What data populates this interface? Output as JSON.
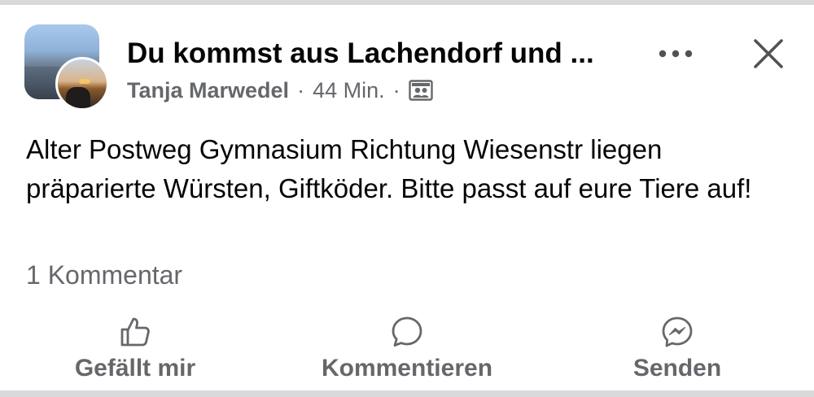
{
  "post": {
    "group_name": "Du kommst aus Lachendorf und ...",
    "author": "Tanja Marwedel",
    "separator": "·",
    "time": "44 Min.",
    "audience_icon": "group-members-icon",
    "text": "Alter Postweg Gymnasium Richtung Wiesenstr liegen präparierte Würsten, Giftköder. Bitte passt auf eure Tiere auf!",
    "comment_count": "1 Kommentar"
  },
  "actions": {
    "like_label": "Gefällt mir",
    "comment_label": "Kommentieren",
    "send_label": "Senden"
  },
  "colors": {
    "primary_text": "#050505",
    "secondary_text": "#65676b",
    "background": "#ffffff",
    "frame": "#d9d9db"
  }
}
